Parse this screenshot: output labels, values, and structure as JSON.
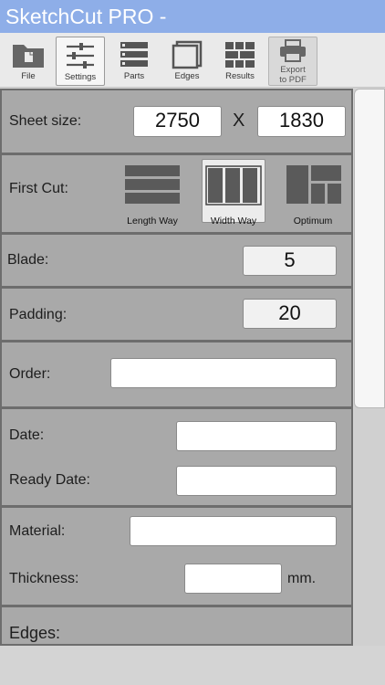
{
  "app": {
    "title": "SketchCut PRO -"
  },
  "toolbar": {
    "items": [
      {
        "label": "File",
        "icon": "folder-icon"
      },
      {
        "label": "Settings",
        "icon": "sliders-icon",
        "active": true
      },
      {
        "label": "Parts",
        "icon": "parts-icon"
      },
      {
        "label": "Edges",
        "icon": "edges-icon"
      },
      {
        "label": "Results",
        "icon": "results-icon"
      },
      {
        "label": "Export to PDF",
        "icon": "printer-icon",
        "disabled": true
      }
    ]
  },
  "sheet": {
    "label": "Sheet size:",
    "width": "2750",
    "separator": "X",
    "height": "1830"
  },
  "first_cut": {
    "label": "First Cut:",
    "options": [
      {
        "label": "Length Way"
      },
      {
        "label": "Width Way",
        "selected": true
      },
      {
        "label": "Optimum"
      }
    ]
  },
  "blade": {
    "label": "Blade:",
    "value": "5"
  },
  "padding": {
    "label": "Padding:",
    "value": "20"
  },
  "order": {
    "label": "Order:",
    "value": ""
  },
  "date": {
    "label": "Date:",
    "value": ""
  },
  "ready_date": {
    "label": "Ready Date:",
    "value": ""
  },
  "material": {
    "label": "Material:",
    "value": ""
  },
  "thickness": {
    "label": "Thickness:",
    "value": "",
    "unit": "mm."
  },
  "edges": {
    "label": "Edges:"
  },
  "colors": {
    "titlebar": "#8eaee8",
    "panel": "#a9a9a9",
    "border": "#6d6d6d"
  }
}
